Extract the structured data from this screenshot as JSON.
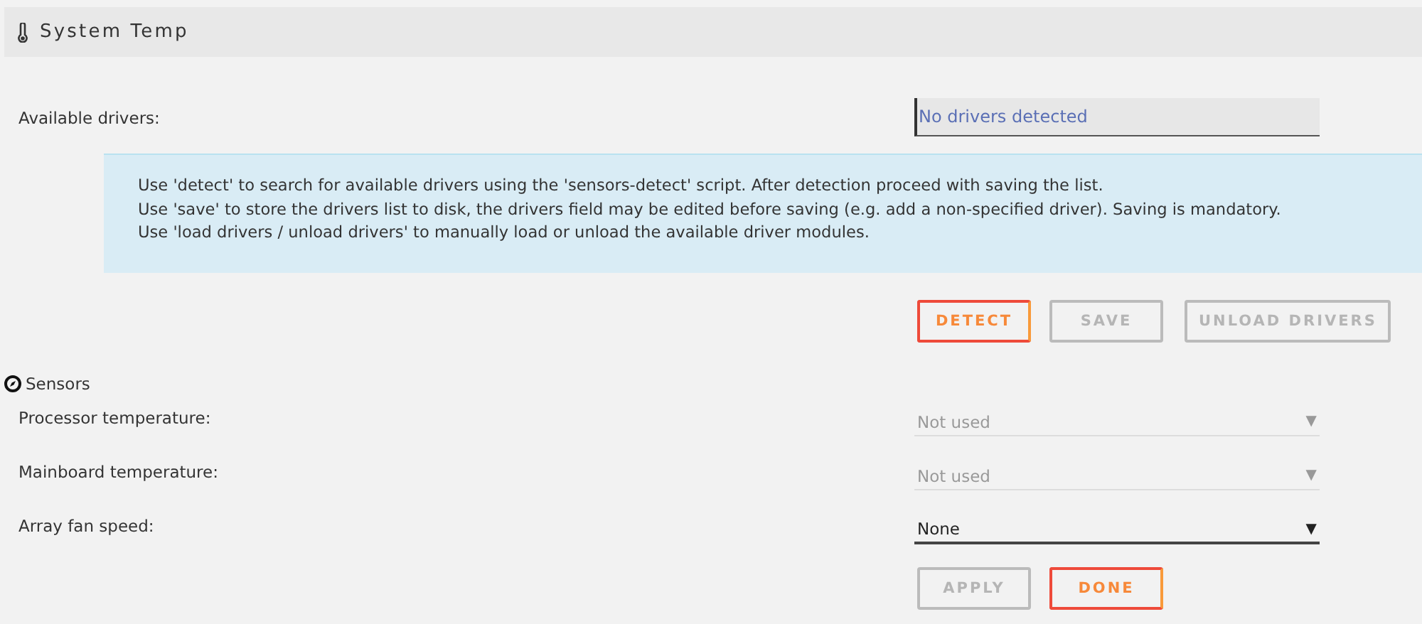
{
  "header": {
    "title": "System Temp"
  },
  "drivers": {
    "label": "Available drivers:",
    "placeholder": "No drivers detected"
  },
  "info": [
    "Use 'detect' to search for available drivers using the 'sensors-detect' script. After detection proceed with saving the list.",
    "Use 'save' to store the drivers list to disk, the drivers field may be edited before saving (e.g. add a non-specified driver). Saving is mandatory.",
    "Use 'load drivers / unload drivers' to manually load or unload the available driver modules."
  ],
  "driver_buttons": [
    {
      "label": "DETECT",
      "disabled": false
    },
    {
      "label": "SAVE",
      "disabled": true
    },
    {
      "label": "UNLOAD DRIVERS",
      "disabled": true
    }
  ],
  "sensors": {
    "title": "Sensors",
    "rows": [
      {
        "label": "Processor temperature:",
        "value": "Not used",
        "arrow": "▼",
        "disabled": true
      },
      {
        "label": "Mainboard temperature:",
        "value": "Not used",
        "arrow": "▼",
        "disabled": true
      },
      {
        "label": "Array fan speed:",
        "value": "None",
        "arrow": "▼",
        "disabled": false
      }
    ]
  },
  "footer_buttons": [
    {
      "label": "APPLY",
      "disabled": true
    },
    {
      "label": "DONE",
      "disabled": false
    }
  ]
}
